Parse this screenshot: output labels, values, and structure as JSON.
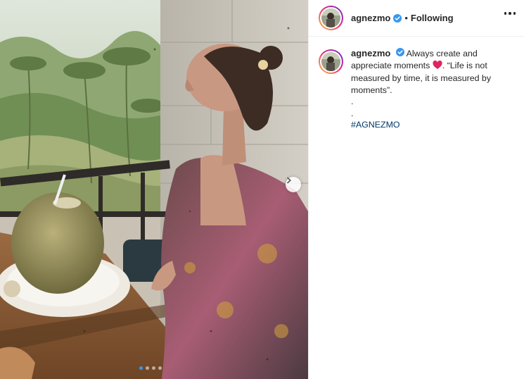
{
  "post": {
    "username": "agnezmo",
    "separator": "•",
    "follow_status": "Following",
    "caption_part1": "Always create and appreciate moments",
    "caption_part2": ". “Life is not measured by time, it is measured by moments”.",
    "caption_dot1": ".",
    "caption_dot2": ".",
    "hashtag": "#AGNEZMO"
  },
  "carousel": {
    "slide": 1,
    "total": 4
  },
  "colors": {
    "accent": "#3897f0",
    "verified": "#3897f0",
    "heart": "#e0245e",
    "hashtag": "#00376b"
  },
  "icons": [
    "verified-badge-icon",
    "more-options-icon",
    "chevron-right-icon",
    "heart-emoji-icon"
  ]
}
